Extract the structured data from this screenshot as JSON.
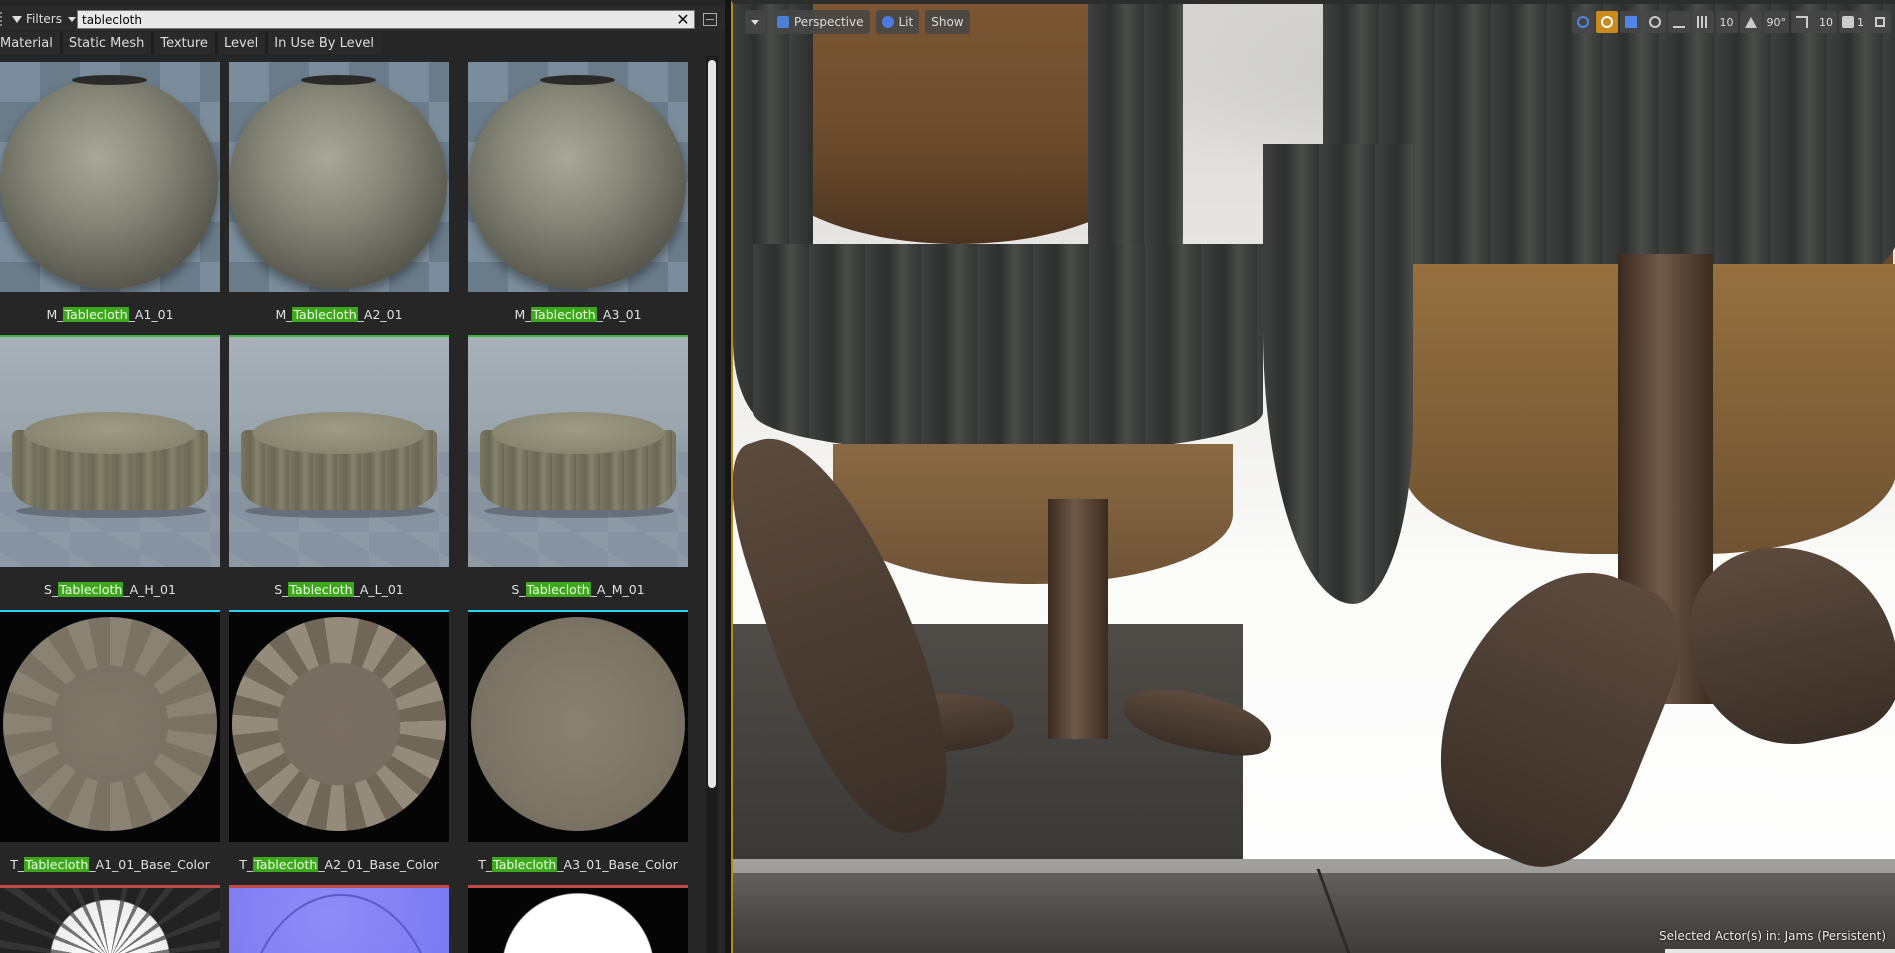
{
  "browser": {
    "filters_label": "Filters",
    "search_value": "tablecloth",
    "clear_glyph": "✕",
    "chips": [
      "Material",
      "Static Mesh",
      "Texture",
      "Level",
      "In Use By Level"
    ],
    "assets": [
      {
        "prefix": "M_",
        "match": "Tablecloth",
        "suffix": "_A1_01",
        "bar_color": "#3fb53c",
        "thumb": "sphere"
      },
      {
        "prefix": "M_",
        "match": "Tablecloth",
        "suffix": "_A2_01",
        "bar_color": "#3fb53c",
        "thumb": "sphere"
      },
      {
        "prefix": "M_",
        "match": "Tablecloth",
        "suffix": "_A3_01",
        "bar_color": "#3fb53c",
        "thumb": "sphere"
      },
      {
        "prefix": "S_",
        "match": "Tablecloth",
        "suffix": "_A_H_01",
        "bar_color": "#27d4f0",
        "thumb": "mesh"
      },
      {
        "prefix": "S_",
        "match": "Tablecloth",
        "suffix": "_A_L_01",
        "bar_color": "#27d4f0",
        "thumb": "mesh"
      },
      {
        "prefix": "S_",
        "match": "Tablecloth",
        "suffix": "_A_M_01",
        "bar_color": "#27d4f0",
        "thumb": "mesh"
      },
      {
        "prefix": "T_",
        "match": "Tablecloth",
        "suffix": "_A1_01_Base_Color",
        "bar_color": "#c44848",
        "thumb": "texture-rays"
      },
      {
        "prefix": "T_",
        "match": "Tablecloth",
        "suffix": "_A2_01_Base_Color",
        "bar_color": "#c44848",
        "thumb": "texture-rays-strong"
      },
      {
        "prefix": "T_",
        "match": "Tablecloth",
        "suffix": "_A3_01_Base_Color",
        "bar_color": "#c44848",
        "thumb": "texture-plain"
      }
    ],
    "partial_row": [
      "mask-texture",
      "normal-texture",
      "mask-texture-round"
    ]
  },
  "viewport": {
    "perspective_label": "Perspective",
    "lit_label": "Lit",
    "show_label": "Show",
    "grid_snap_value": "10",
    "rotation_snap_value": "90°",
    "scale_snap_value": "10",
    "camera_speed_value": "1",
    "status_text": "Selected Actor(s) in:  Jams (Persistent)",
    "accent_color": "#c98a1e",
    "icons": [
      "translate-icon",
      "rotate-icon",
      "scale-icon",
      "world-local-icon",
      "surface-snap-icon",
      "grid-snap-icon",
      "rotation-snap-icon",
      "scale-snap-icon",
      "camera-speed-icon",
      "maximize-icon"
    ]
  }
}
